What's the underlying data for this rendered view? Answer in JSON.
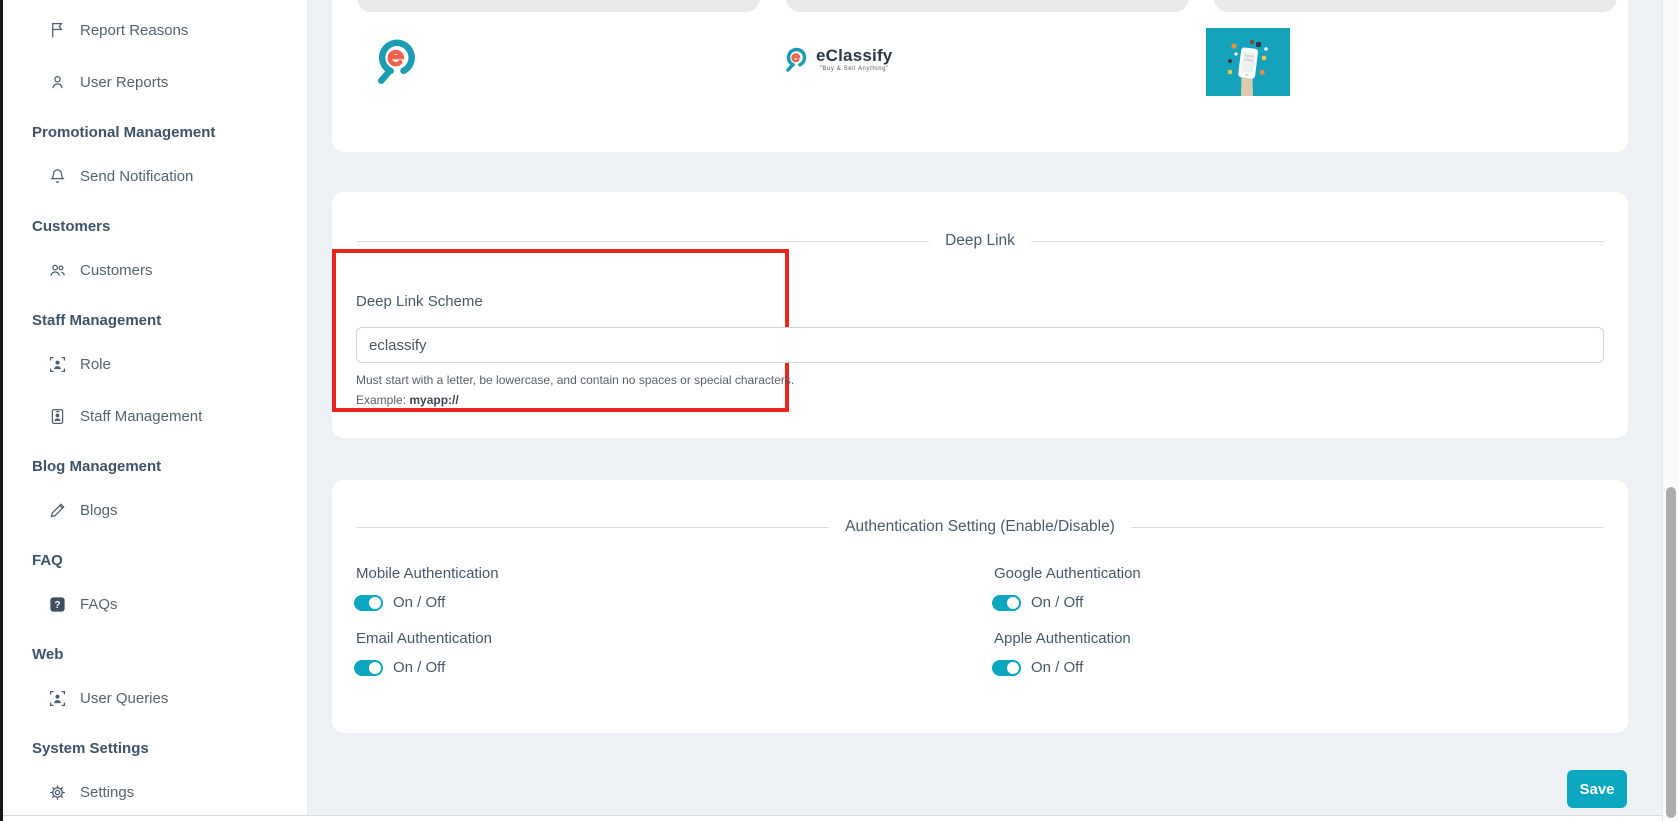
{
  "colors": {
    "accent_teal": "#0ba7c0",
    "annotation_red": "#e8261c",
    "logo_teal": "#1b9cb5",
    "logo_orange": "#f0604d",
    "promo_image_bg": "#14a3ba"
  },
  "sidebar": {
    "rows": [
      {
        "type": "item",
        "icon": "flag-icon",
        "label": "Report Reasons"
      },
      {
        "type": "item",
        "icon": "person-icon",
        "label": "User Reports"
      },
      {
        "type": "header",
        "label": "Promotional Management"
      },
      {
        "type": "item",
        "icon": "bell-icon",
        "label": "Send Notification"
      },
      {
        "type": "header",
        "label": "Customers"
      },
      {
        "type": "item",
        "icon": "people-icon",
        "label": "Customers"
      },
      {
        "type": "header",
        "label": "Staff Management"
      },
      {
        "type": "item",
        "icon": "person-bounding-box-icon",
        "label": "Role"
      },
      {
        "type": "item",
        "icon": "person-badge-icon",
        "label": "Staff Management"
      },
      {
        "type": "header",
        "label": "Blog Management"
      },
      {
        "type": "item",
        "icon": "pencil-icon",
        "label": "Blogs"
      },
      {
        "type": "header",
        "label": "FAQ"
      },
      {
        "type": "item",
        "icon": "question-square-icon",
        "label": "FAQs"
      },
      {
        "type": "header",
        "label": "Web"
      },
      {
        "type": "item",
        "icon": "person-bounding-box-icon",
        "label": "User Queries"
      },
      {
        "type": "header",
        "label": "System Settings"
      },
      {
        "type": "item",
        "icon": "gear-icon",
        "label": "Settings"
      }
    ]
  },
  "logos": {
    "brand_name": "eClassify",
    "brand_tagline": "\"Buy & Sell Anything\""
  },
  "deep_link": {
    "section_title": "Deep Link",
    "field_label": "Deep Link Scheme",
    "field_value": "eclassify",
    "helper_text": "Must start with a letter, be lowercase, and contain no spaces or special characters.",
    "example_prefix": "Example: ",
    "example_value": "myapp://"
  },
  "authentication": {
    "section_title": "Authentication Setting (Enable/Disable)",
    "toggles": [
      {
        "label": "Mobile Authentication",
        "state_text": "On / Off",
        "on": true
      },
      {
        "label": "Email Authentication",
        "state_text": "On / Off",
        "on": true
      },
      {
        "label": "Google Authentication",
        "state_text": "On / Off",
        "on": true
      },
      {
        "label": "Apple Authentication",
        "state_text": "On / Off",
        "on": true
      }
    ]
  },
  "footer": {
    "save_label": "Save"
  }
}
